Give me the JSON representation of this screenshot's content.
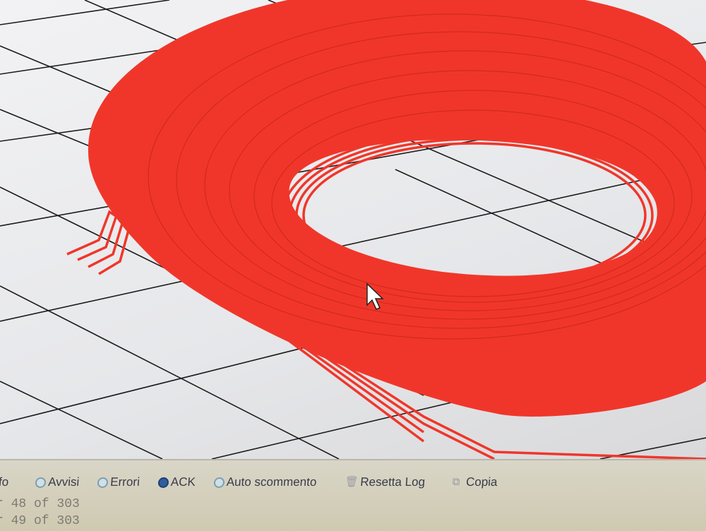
{
  "log_filters": {
    "info_partial": "fo",
    "warnings": "Avvisi",
    "errors": "Errori",
    "ack": "ACK",
    "autoscroll": "Auto scommento",
    "reset_log": "Resetta Log",
    "copy": "Copia"
  },
  "log_lines": [
    "r 48 of 303",
    "r 49 of 303"
  ],
  "colors": {
    "model": "#f0362a",
    "grid": "#1c1c1c",
    "background": "#eeeef0",
    "log_bg": "#d3cdb6"
  }
}
